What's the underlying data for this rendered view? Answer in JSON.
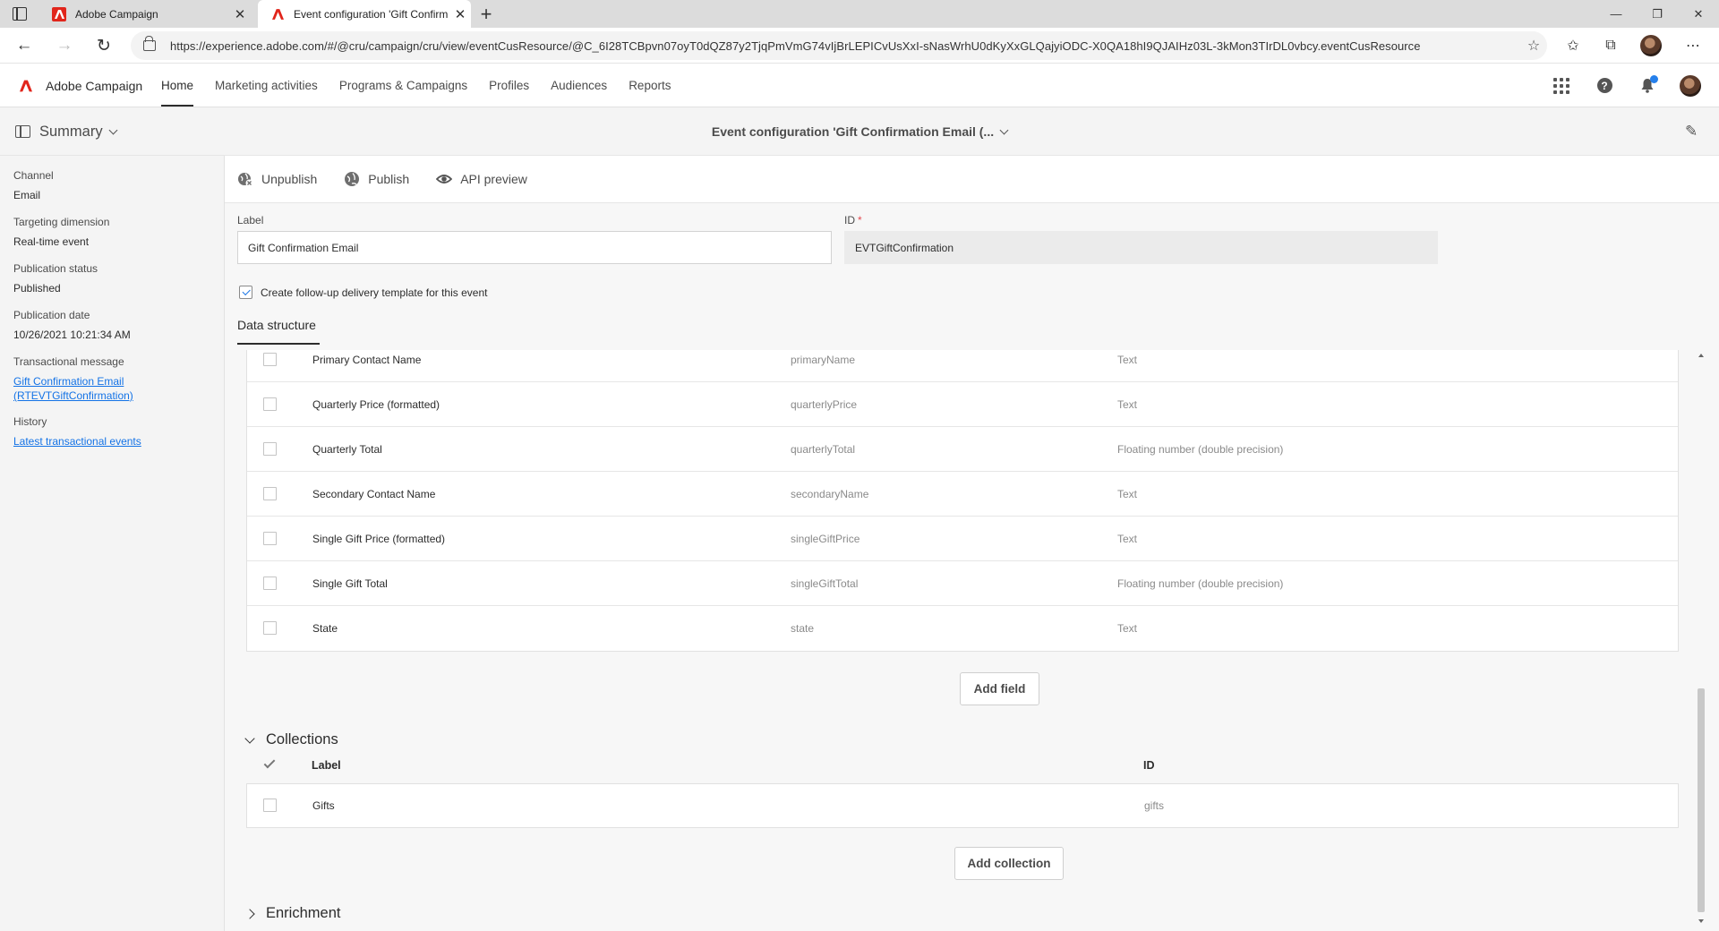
{
  "browser": {
    "tabs": [
      {
        "label": "Adobe Campaign",
        "active": false
      },
      {
        "label": "Event configuration 'Gift Confirm",
        "active": true
      }
    ],
    "url": "https://experience.adobe.com/#/@cru/campaign/cru/view/eventCusResource/@C_6I28TCBpvn07oyT0dQZ87y2TjqPmVmG74vIjBrLEPICvUsXxI-sNasWrhU0dKyXxGLQajyiODC-X0QA18hI9QJAIHz03L-3kMon3TIrDL0vbcy.eventCusResource"
  },
  "app": {
    "brand": "Adobe Campaign",
    "nav": [
      "Home",
      "Marketing activities",
      "Programs & Campaigns",
      "Profiles",
      "Audiences",
      "Reports"
    ],
    "active_nav": "Home"
  },
  "subheader": {
    "summary_label": "Summary",
    "title": "Event configuration 'Gift Confirmation Email (..."
  },
  "summary": {
    "channel_label": "Channel",
    "channel_value": "Email",
    "targeting_label": "Targeting dimension",
    "targeting_value": "Real-time event",
    "status_label": "Publication status",
    "status_value": "Published",
    "date_label": "Publication date",
    "date_value": "10/26/2021 10:21:34 AM",
    "txmsg_label": "Transactional message",
    "txmsg_link_line1": "Gift Confirmation Email",
    "txmsg_link_line2": "(RTEVTGiftConfirmation)",
    "history_label": "History",
    "history_link": "Latest transactional events"
  },
  "actions": {
    "unpublish": "Unpublish",
    "publish": "Publish",
    "api_preview": "API preview"
  },
  "form": {
    "label_caption": "Label",
    "label_value": "Gift Confirmation Email",
    "id_caption": "ID",
    "id_required_mark": "*",
    "id_value": "EVTGiftConfirmation",
    "followup_checkbox_label": "Create follow-up delivery template for this event",
    "followup_checked": true,
    "data_structure_tab": "Data structure"
  },
  "fields": [
    {
      "label": "Primary Contact Name",
      "id": "primaryName",
      "type": "Text"
    },
    {
      "label": "Quarterly Price (formatted)",
      "id": "quarterlyPrice",
      "type": "Text"
    },
    {
      "label": "Quarterly Total",
      "id": "quarterlyTotal",
      "type": "Floating number (double precision)"
    },
    {
      "label": "Secondary Contact Name",
      "id": "secondaryName",
      "type": "Text"
    },
    {
      "label": "Single Gift Price (formatted)",
      "id": "singleGiftPrice",
      "type": "Text"
    },
    {
      "label": "Single Gift Total",
      "id": "singleGiftTotal",
      "type": "Floating number (double precision)"
    },
    {
      "label": "State",
      "id": "state",
      "type": "Text"
    }
  ],
  "add_field_label": "Add field",
  "collections": {
    "title": "Collections",
    "col_label": "Label",
    "col_id": "ID",
    "rows": [
      {
        "label": "Gifts",
        "id": "gifts"
      }
    ],
    "add_label": "Add collection"
  },
  "enrichment": {
    "title": "Enrichment"
  }
}
